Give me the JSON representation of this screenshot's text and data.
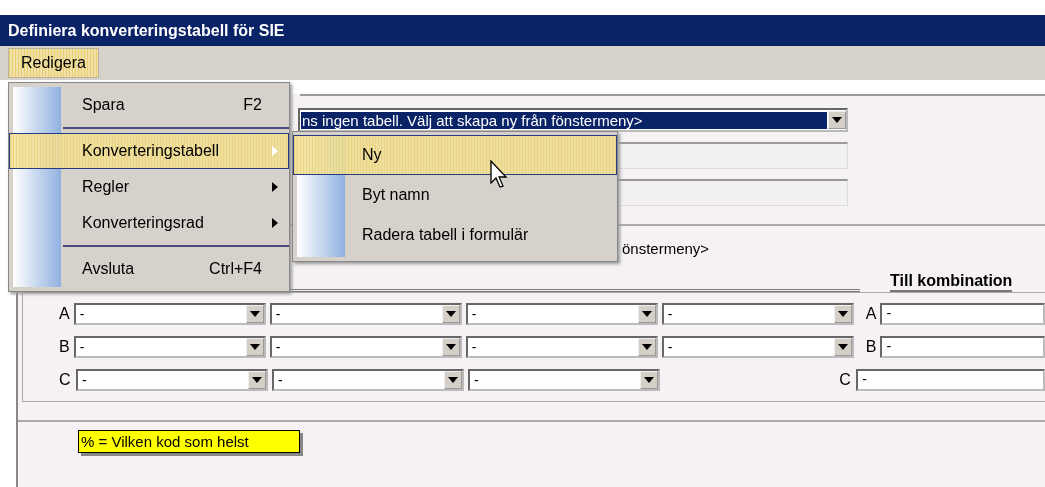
{
  "window": {
    "title": "Definiera konverteringstabell för SIE"
  },
  "menubar": [
    {
      "label": "Redigera",
      "selected": true
    }
  ],
  "menu": {
    "items": [
      {
        "kind": "item",
        "label": "Spara",
        "shortcut": "F2",
        "submenu": false,
        "selected": false
      },
      {
        "kind": "separator"
      },
      {
        "kind": "item",
        "label": "Konverteringstabell",
        "submenu": true,
        "selected": true
      },
      {
        "kind": "item",
        "label": "Regler",
        "submenu": true,
        "selected": false
      },
      {
        "kind": "item",
        "label": "Konverteringsrad",
        "submenu": true,
        "selected": false
      },
      {
        "kind": "separator"
      },
      {
        "kind": "item",
        "label": "Avsluta",
        "shortcut": "Ctrl+F4",
        "submenu": false,
        "selected": false
      }
    ]
  },
  "submenu": {
    "items": [
      {
        "label": "Ny",
        "selected": true
      },
      {
        "label": "Byt namn",
        "selected": false
      },
      {
        "label": "Radera tabell i formulär",
        "selected": false
      }
    ]
  },
  "table_select": {
    "value": "ns ingen tabell. Välj att skapa ny från fönstermeny>"
  },
  "info_text": "önstermeny>",
  "target_heading": "Till kombination",
  "rows": [
    {
      "label": "A",
      "source": [
        {
          "value": "-"
        },
        {
          "value": "-"
        },
        {
          "value": "-"
        },
        {
          "value": "-"
        }
      ],
      "target_label": "A",
      "target": "-"
    },
    {
      "label": "B",
      "source": [
        {
          "value": "-"
        },
        {
          "value": "-"
        },
        {
          "value": "-"
        },
        {
          "value": "-"
        }
      ],
      "target_label": "B",
      "target": "-"
    },
    {
      "label": "C",
      "source": [
        {
          "value": "-"
        },
        {
          "value": "-"
        },
        {
          "value": "-"
        }
      ],
      "target_label": "C",
      "target": "-"
    }
  ],
  "note": "% = Vilken kod som helst"
}
